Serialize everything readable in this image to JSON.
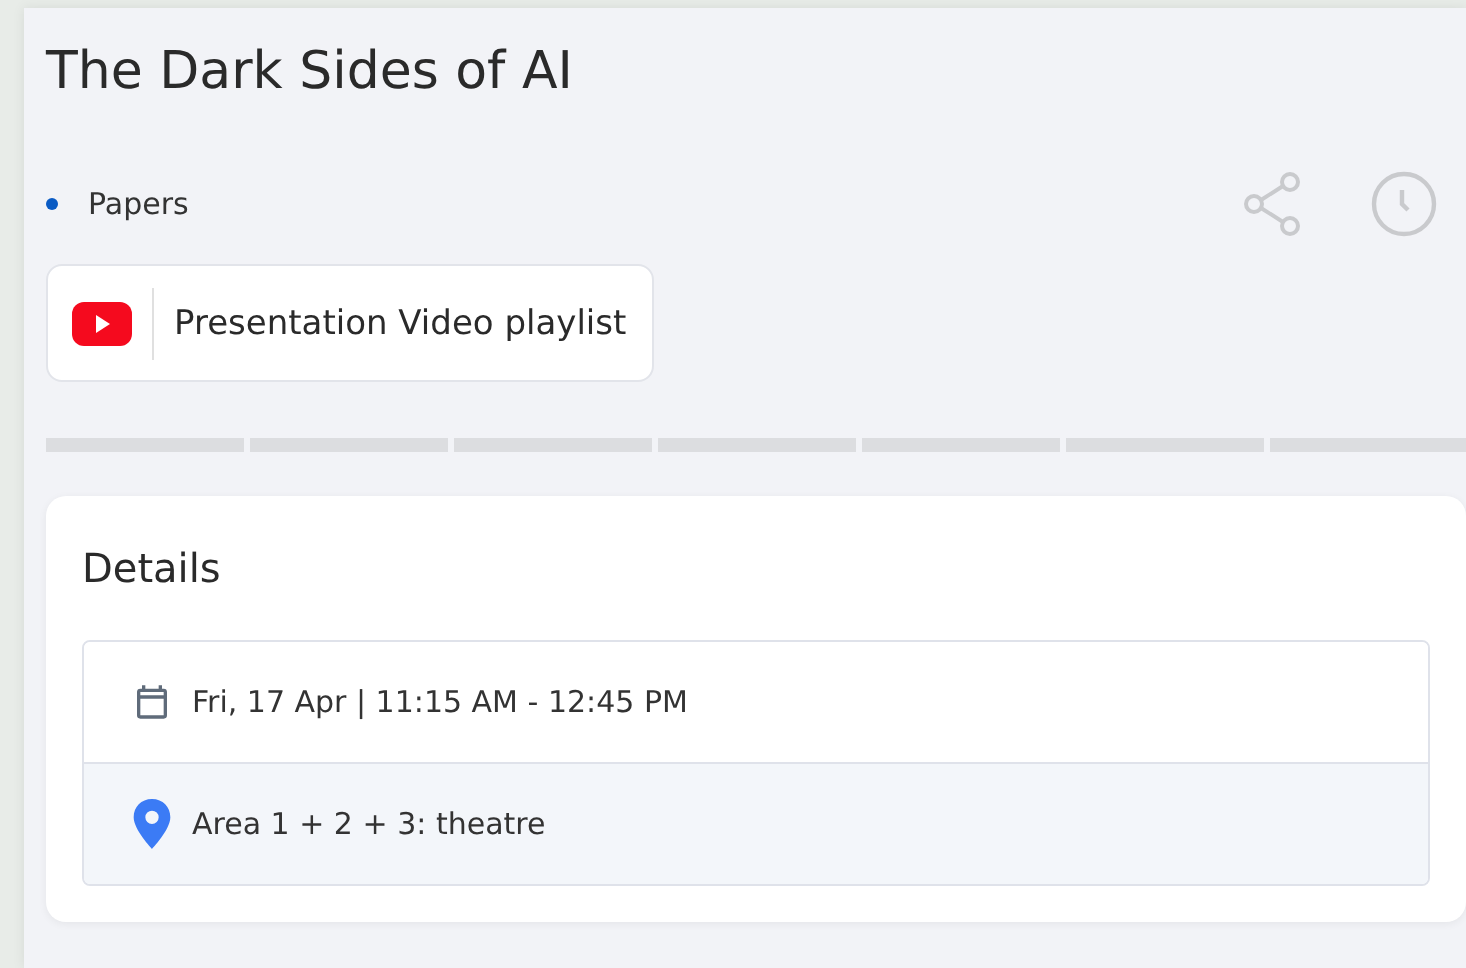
{
  "title": "The Dark Sides of AI",
  "category": {
    "label": "Papers",
    "color": "#0a5bc4"
  },
  "media_button": {
    "label": "Presentation Video playlist"
  },
  "details": {
    "heading": "Details",
    "rows": [
      {
        "kind": "date",
        "text": "Fri, 17 Apr | 11:15 AM - 12:45 PM"
      },
      {
        "kind": "location",
        "text": "Area 1 + 2 + 3: theatre"
      }
    ]
  }
}
